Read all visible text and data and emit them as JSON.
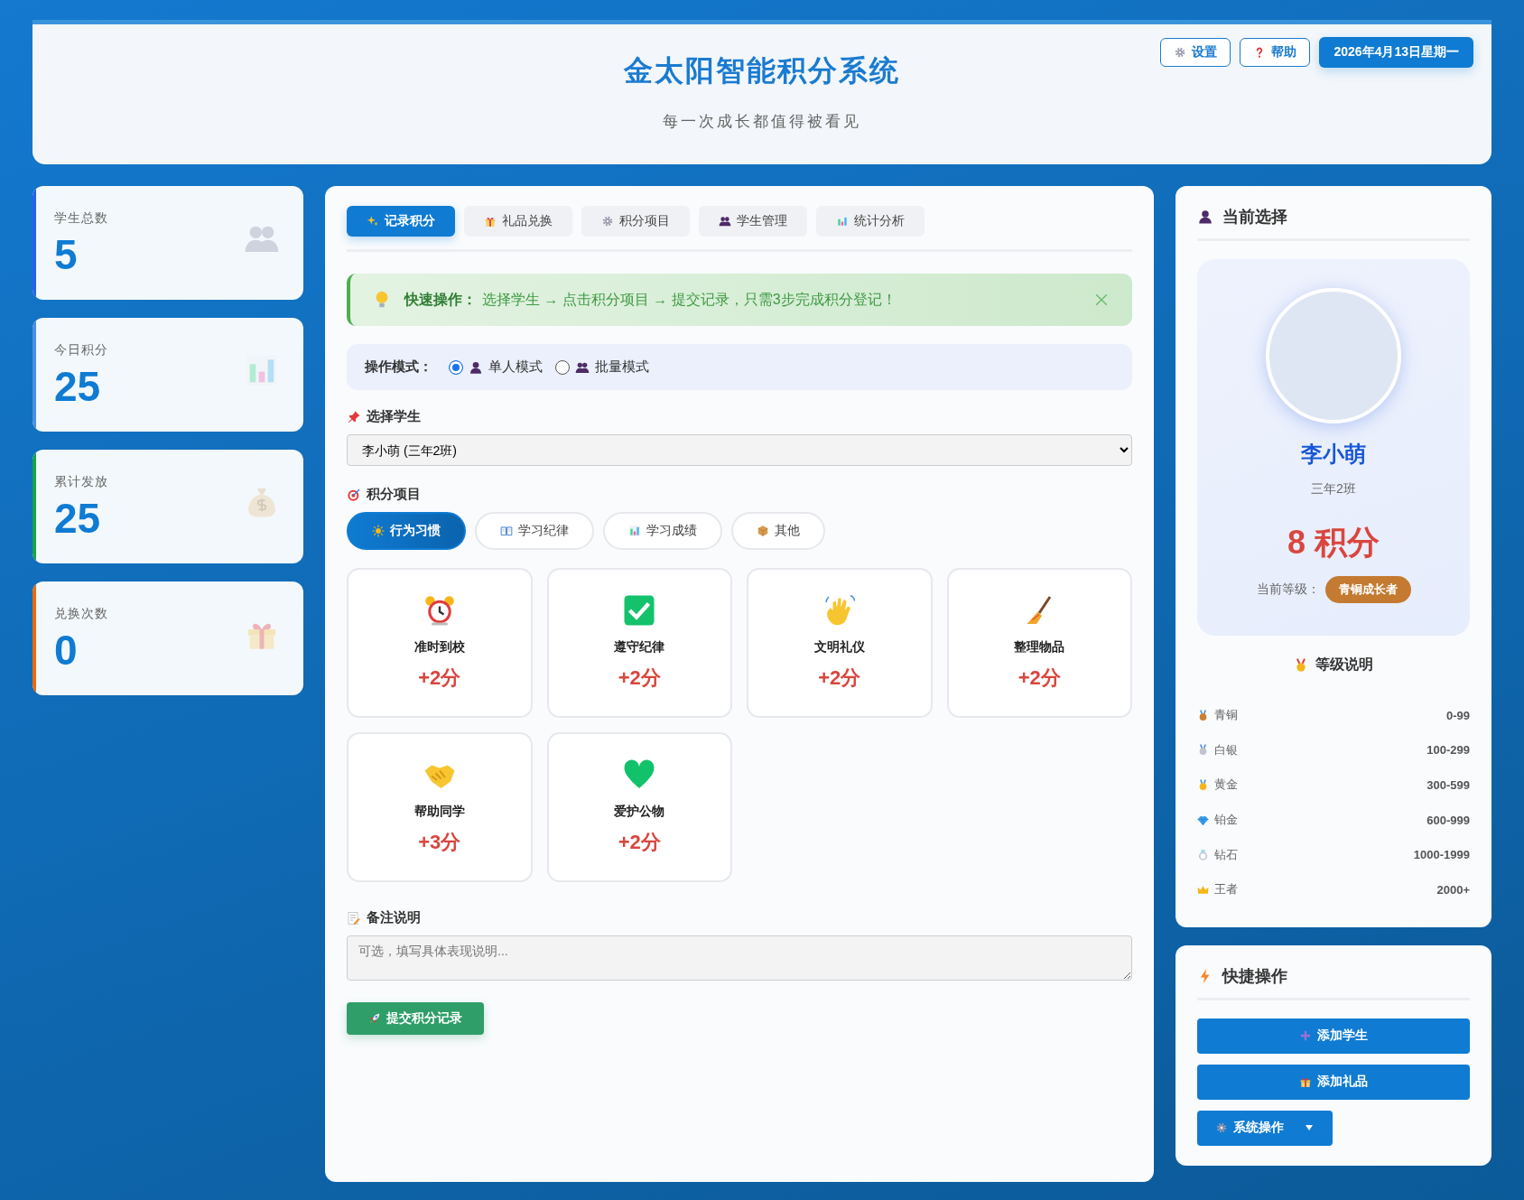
{
  "header": {
    "title": "金太阳智能积分系统",
    "subtitle": "每一次成长都值得被看见",
    "buttons": [
      {
        "label": "设置"
      },
      {
        "label": "帮助"
      }
    ],
    "date": "2026年4月13日星期一"
  },
  "stats": [
    {
      "label": "学生总数",
      "value": "5",
      "color": "#2563eb"
    },
    {
      "label": "今日积分",
      "value": "25",
      "color": "#4a90e2"
    },
    {
      "label": "累计发放",
      "value": "25",
      "color": "#16a34a"
    },
    {
      "label": "兑换次数",
      "value": "0",
      "color": "#ea6a0c"
    }
  ],
  "tabs": [
    {
      "label": "记录积分",
      "selected": true
    },
    {
      "label": "礼品兑换",
      "selected": false
    },
    {
      "label": "积分项目",
      "selected": false
    },
    {
      "label": "学生管理",
      "selected": false
    },
    {
      "label": "统计分析",
      "selected": false
    }
  ],
  "tip": {
    "title": "快速操作：",
    "text": "选择学生 → 点击积分项目 → 提交记录，只需3步完成积分登记！"
  },
  "mode": {
    "label": "操作模式：",
    "options": [
      {
        "label": "单人模式",
        "selected": true
      },
      {
        "label": "批量模式",
        "selected": false
      }
    ]
  },
  "student_select": {
    "label": "选择学生",
    "value": "李小萌 (三年2班)"
  },
  "points_items": {
    "label": "积分项目",
    "categories": [
      {
        "label": "行为习惯",
        "selected": true
      },
      {
        "label": "学习纪律",
        "selected": false
      },
      {
        "label": "学习成绩",
        "selected": false
      },
      {
        "label": "其他",
        "selected": false
      }
    ],
    "items": [
      {
        "name": "准时到校",
        "points": "+2分"
      },
      {
        "name": "遵守纪律",
        "points": "+2分"
      },
      {
        "name": "文明礼仪",
        "points": "+2分"
      },
      {
        "name": "整理物品",
        "points": "+2分"
      },
      {
        "name": "帮助同学",
        "points": "+3分"
      },
      {
        "name": "爱护公物",
        "points": "+2分"
      }
    ]
  },
  "note": {
    "label": "备注说明",
    "placeholder": "可选，填写具体表现说明..."
  },
  "submit_button": "提交积分记录",
  "current": {
    "title": "当前选择",
    "name": "李小萌",
    "class_name": "三年2班",
    "points": "8 积分",
    "level_label": "当前等级：",
    "level_badge": "青铜成长者"
  },
  "levels": {
    "title": "等级说明",
    "rows": [
      {
        "name": "青铜",
        "range": "0-99"
      },
      {
        "name": "白银",
        "range": "100-299"
      },
      {
        "name": "黄金",
        "range": "300-599"
      },
      {
        "name": "铂金",
        "range": "600-999"
      },
      {
        "name": "钻石",
        "range": "1000-1999"
      },
      {
        "name": "王者",
        "range": "2000+"
      }
    ]
  },
  "quick": {
    "title": "快捷操作",
    "buttons": [
      {
        "label": "添加学生",
        "kind": "button"
      },
      {
        "label": "添加礼品",
        "kind": "button"
      },
      {
        "label": "系统操作",
        "kind": "dropdown"
      }
    ]
  }
}
